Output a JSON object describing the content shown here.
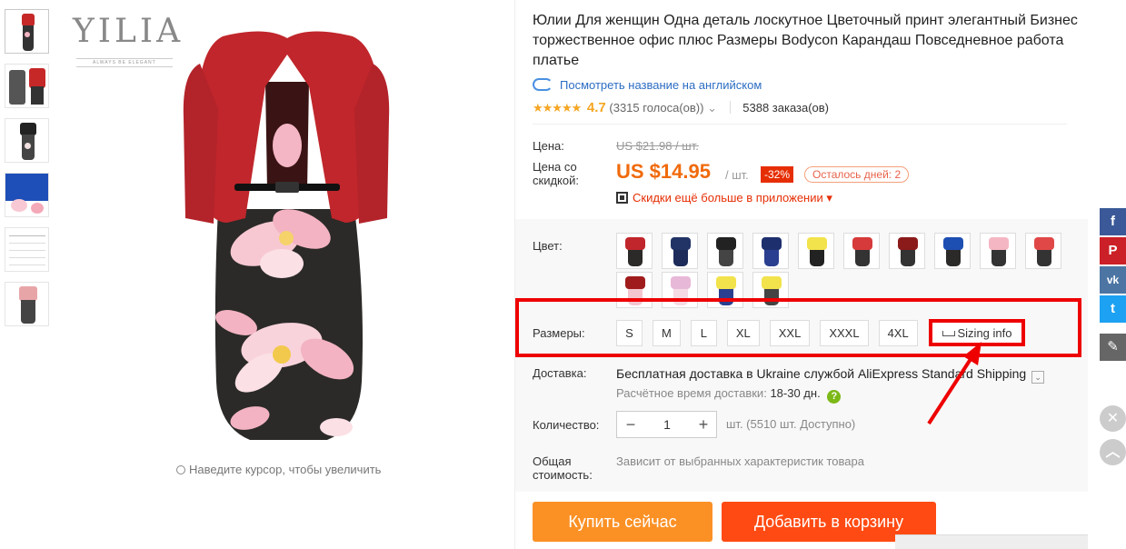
{
  "brand": {
    "logo": "YILIA",
    "slogan": "ALWAYS BE ELEGANT"
  },
  "gallery": {
    "zoom_hint": "Наведите курсор, чтобы увеличить"
  },
  "product": {
    "title": "Юлии Для женщин Одна деталь лоскутное Цветочный принт элегантный Бизнес торжественное офис плюс Размеры Bodycon Карандаш Повседневное работа платье",
    "translate_link": "Посмотреть название на английском",
    "stars": "★★★★★",
    "rating": "4.7",
    "votes": "(3315 голоса(ов))",
    "votes_caret": "⌄",
    "orders": "5388 заказа(ов)"
  },
  "price": {
    "label": "Цена:",
    "old": "US $21.98 / шт.",
    "discount_label": "Цена со скидкой:",
    "current": "US $14.95",
    "unit": "/ шт.",
    "discount_badge": "-32%",
    "days_left": "Осталось дней: 2",
    "app_discount": "Скидки ещё больше в приложении ▾"
  },
  "color": {
    "label": "Цвет:"
  },
  "sizes": {
    "label": "Размеры:",
    "options": [
      "S",
      "M",
      "L",
      "XL",
      "XXL",
      "XXXL",
      "4XL"
    ],
    "sizing_info": "Sizing info"
  },
  "shipping": {
    "label": "Доставка:",
    "method": "Бесплатная доставка в Ukraine службой AliExpress Standard Shipping",
    "dropdown": "⌄",
    "time_label": "Расчётное время доставки:",
    "time_value": "18-30 дн.",
    "help": "?"
  },
  "quantity": {
    "label": "Количество:",
    "minus": "−",
    "value": "1",
    "plus": "+",
    "available": "шт. (5510 шт. Доступно)"
  },
  "total": {
    "label": "Общая стоимость:",
    "value": "Зависит от выбранных характеристик товара"
  },
  "actions": {
    "buy_now": "Купить сейчас",
    "add_to_cart": "Добавить в корзину"
  },
  "social": {
    "facebook": "f",
    "pinterest": "P",
    "vk": "vk",
    "twitter": "t",
    "edit": "✎",
    "close": "✕",
    "up": "︿"
  },
  "colors_accent": {
    "price": "#f06a0c",
    "buy": "#fb9125",
    "cart": "#ff4b13",
    "highlight": "#ee0000"
  }
}
